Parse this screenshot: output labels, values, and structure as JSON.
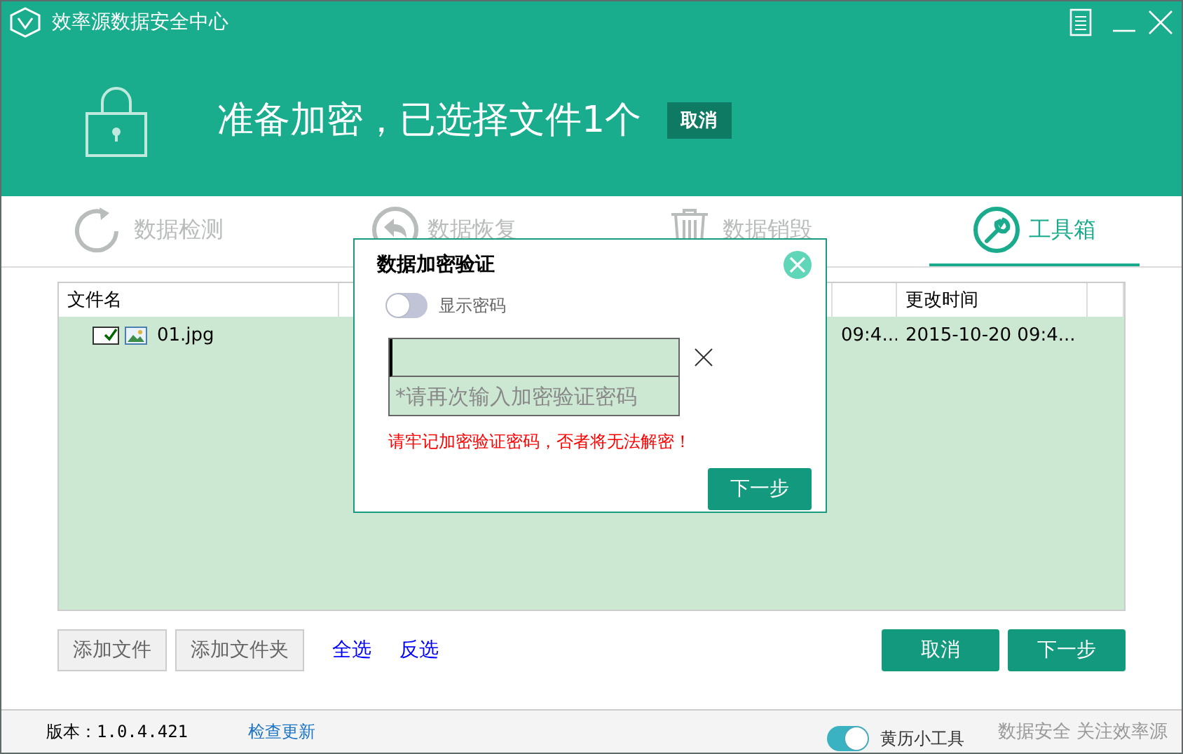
{
  "window": {
    "title": "效率源数据安全中心"
  },
  "header": {
    "headline": "准备加密，已选择文件1个",
    "cancel_button": "取消"
  },
  "tabs": [
    {
      "label": "数据检测",
      "selected": false
    },
    {
      "label": "数据恢复",
      "selected": false
    },
    {
      "label": "数据销毁",
      "selected": false
    },
    {
      "label": "工具箱",
      "selected": true
    }
  ],
  "table": {
    "columns": [
      "文件名",
      "更改时间"
    ],
    "rows": [
      {
        "checked": true,
        "name": "01.jpg",
        "cells": [
          "09:4...",
          "2015-10-20 09:4..."
        ]
      }
    ]
  },
  "actions": {
    "buttons": [
      "添加文件",
      "添加文件夹"
    ],
    "links": [
      "全选",
      "反选"
    ],
    "cancel": "取消",
    "next": "下一步"
  },
  "dialog": {
    "title": "数据加密验证",
    "show_password": {
      "label": "显示密码",
      "on": false
    },
    "confirm": {
      "placeholder": "*请再次输入加密验证密码"
    },
    "warning": "请牢记加密验证密码，否者将无法解密！",
    "next": "下一步"
  },
  "status_bar": {
    "version": "版本：1.0.4.421",
    "update_link": "检查更新",
    "almanac": {
      "label": "黄历小工具",
      "on": true
    },
    "slogan": "数据安全 关注效率源"
  }
}
